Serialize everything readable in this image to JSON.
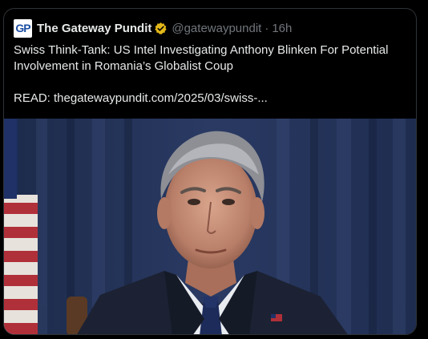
{
  "tweet": {
    "author_name": "The Gateway Pundit",
    "avatar_text": "GP",
    "handle": "@gatewaypundit",
    "separator": "·",
    "timestamp": "16h",
    "headline": "Swiss Think-Tank: US Intel Investigating Anthony Blinken For Potential Involvement in Romania’s Globalist Coup",
    "read_link": "READ: thegatewaypundit.com/2025/03/swiss-...",
    "badge_icon": "gold-verified-badge-icon",
    "badge_color": "#e2b719"
  },
  "media": {
    "icon": "photo",
    "description_icon": "man-in-suit-portrait"
  }
}
